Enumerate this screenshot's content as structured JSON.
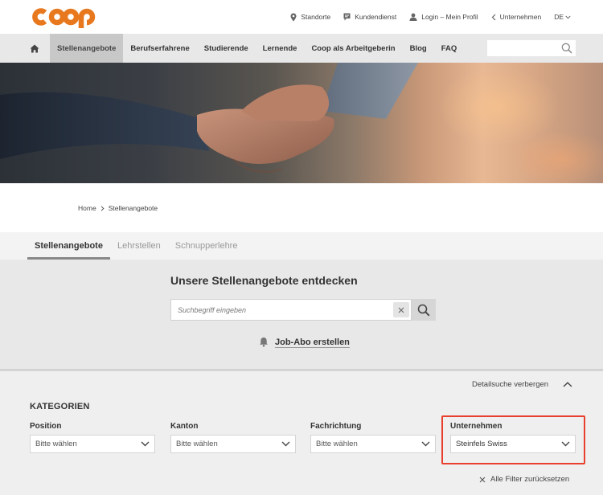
{
  "brand": {
    "logo_text": "coop",
    "color": "#e8781e"
  },
  "toplinks": [
    {
      "label": "Standorte",
      "icon": "location-pin-icon"
    },
    {
      "label": "Kundendienst",
      "icon": "chat-icon"
    },
    {
      "label": "Login – Mein Profil",
      "icon": "user-icon"
    },
    {
      "label": "Unternehmen",
      "icon": "chevron-left-icon"
    },
    {
      "label": "DE",
      "icon": "chevron-down-icon"
    }
  ],
  "nav": {
    "items": [
      {
        "label": "Stellenangebote",
        "active": true
      },
      {
        "label": "Berufserfahrene",
        "active": false
      },
      {
        "label": "Studierende",
        "active": false
      },
      {
        "label": "Lernende",
        "active": false
      },
      {
        "label": "Coop als Arbeitgeberin",
        "active": false
      },
      {
        "label": "Blog",
        "active": false
      },
      {
        "label": "FAQ",
        "active": false
      }
    ],
    "search_value": ""
  },
  "breadcrumb": {
    "home": "Home",
    "current": "Stellenangebote"
  },
  "tabs": [
    {
      "label": "Stellenangebote",
      "active": true
    },
    {
      "label": "Lehrstellen",
      "active": false
    },
    {
      "label": "Schnupperlehre",
      "active": false
    }
  ],
  "search": {
    "title": "Unsere Stellenangebote entdecken",
    "placeholder": "Suchbegriff eingeben",
    "job_abo": "Job-Abo erstellen"
  },
  "filters": {
    "toggle_label": "Detailsuche verbergen",
    "category_title": "KATEGORIEN",
    "fields": [
      {
        "label": "Position",
        "value": "Bitte wählen"
      },
      {
        "label": "Kanton",
        "value": "Bitte wählen"
      },
      {
        "label": "Fachrichtung",
        "value": "Bitte wählen"
      },
      {
        "label": "Unternehmen",
        "value": "Steinfels Swiss"
      }
    ],
    "reset_label": "Alle Filter zurücksetzen",
    "highlight_color": "#e8402f"
  }
}
